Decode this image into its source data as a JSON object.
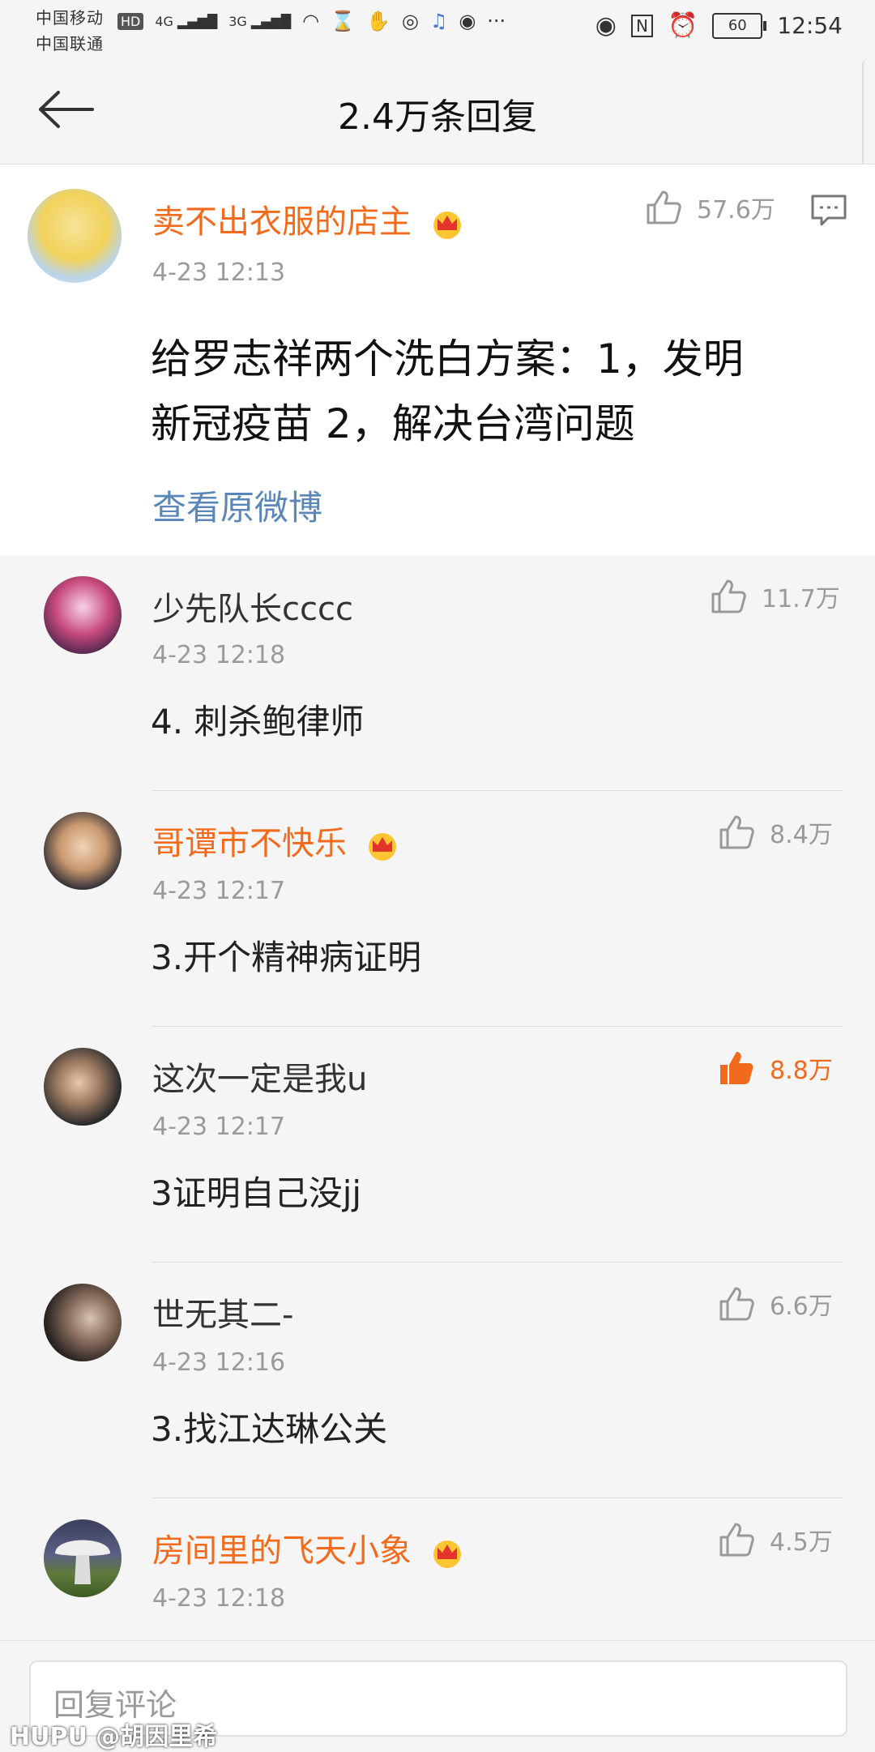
{
  "status_bar": {
    "carrier1": "中国移动",
    "carrier2": "中国联通",
    "hd": "HD",
    "net1": "4G",
    "net2": "3G",
    "battery": "60",
    "time": "12:54",
    "more": "···"
  },
  "header": {
    "title": "2.4万条回复"
  },
  "main_post": {
    "username": "卖不出衣服的店主",
    "time": "4-23 12:13",
    "likes": "57.6万",
    "text_line1": "给罗志祥两个洗白方案：1，发明",
    "text_line2": "新冠疫苗 2，解决台湾问题",
    "view_original": "查看原微博"
  },
  "comments": [
    {
      "username": "少先队长cccc",
      "time": "4-23 12:18",
      "likes": "11.7万",
      "text": "4. 刺杀鲍律师",
      "vip": false,
      "liked": false
    },
    {
      "username": "哥谭市不快乐",
      "time": "4-23 12:17",
      "likes": "8.4万",
      "text": "3.开个精神病证明",
      "vip": true,
      "liked": false
    },
    {
      "username": "这次一定是我u",
      "time": "4-23 12:17",
      "likes": "8.8万",
      "text": "3证明自己没jj",
      "vip": false,
      "liked": true
    },
    {
      "username": "世无其二-",
      "time": "4-23 12:16",
      "likes": "6.6万",
      "text": "3.找江达琳公关",
      "vip": false,
      "liked": false
    },
    {
      "username": "房间里的飞天小象",
      "time": "4-23 12:18",
      "likes": "4.5万",
      "text": "",
      "vip": true,
      "liked": false
    }
  ],
  "reply": {
    "placeholder": "回复评论"
  },
  "watermark": "HUPU @胡因里希",
  "colors": {
    "accent": "#f26b1d",
    "link": "#5b86b8",
    "muted": "#9a9a9a"
  }
}
